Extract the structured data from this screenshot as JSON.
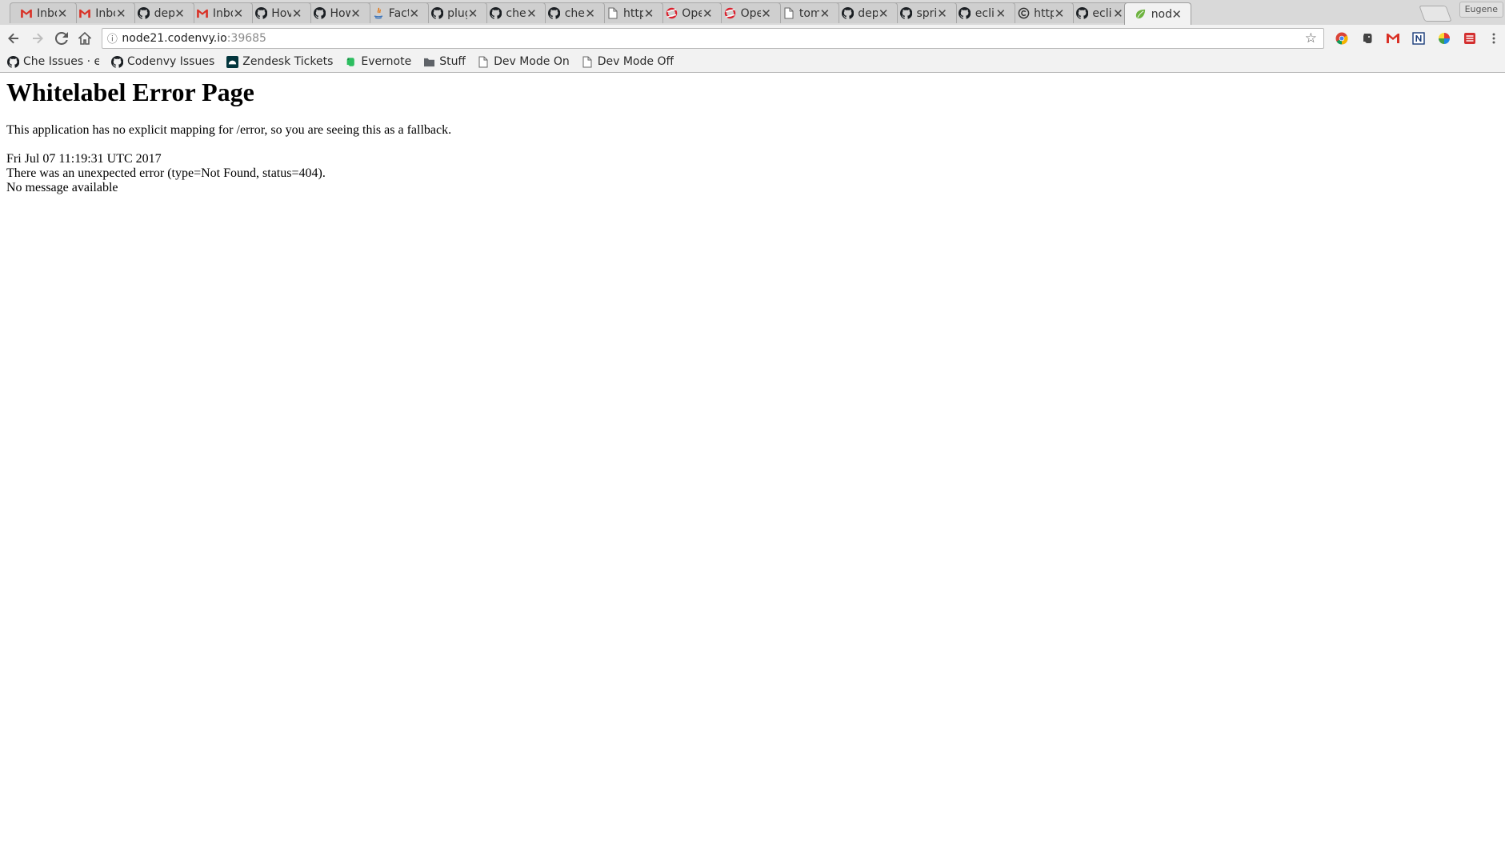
{
  "browser": {
    "profile_name": "Eugene",
    "tabs": [
      {
        "title": "Inbo",
        "icon": "gmail-icon"
      },
      {
        "title": "Inbo",
        "icon": "gmail-icon"
      },
      {
        "title": "dep",
        "icon": "github-icon"
      },
      {
        "title": "Inbo",
        "icon": "gmail-icon"
      },
      {
        "title": "Hov",
        "icon": "github-icon"
      },
      {
        "title": "How",
        "icon": "github-icon"
      },
      {
        "title": "Fact",
        "icon": "java-icon"
      },
      {
        "title": "plug",
        "icon": "github-icon"
      },
      {
        "title": "che",
        "icon": "github-icon"
      },
      {
        "title": "che",
        "icon": "github-icon"
      },
      {
        "title": "http",
        "icon": "document-icon"
      },
      {
        "title": "Ope",
        "icon": "openshift-icon"
      },
      {
        "title": "Ope",
        "icon": "openshift-icon"
      },
      {
        "title": "tom",
        "icon": "document-icon"
      },
      {
        "title": "dep",
        "icon": "github-icon"
      },
      {
        "title": "spri",
        "icon": "github-icon"
      },
      {
        "title": "eclip",
        "icon": "github-icon"
      },
      {
        "title": "http",
        "icon": "copyright-icon"
      },
      {
        "title": "eclip",
        "icon": "github-icon"
      },
      {
        "title": "nod",
        "icon": "spring-leaf-icon",
        "active": true
      }
    ],
    "address": {
      "host": "node21.codenvy.io",
      "port": ":39685"
    },
    "bookmarks": [
      {
        "label": "Che Issues · eclip",
        "icon": "github-icon"
      },
      {
        "label": "Codenvy Issues",
        "icon": "github-icon"
      },
      {
        "label": "Zendesk Tickets",
        "icon": "zendesk-icon"
      },
      {
        "label": "Evernote",
        "icon": "evernote-icon"
      },
      {
        "label": "Stuff",
        "icon": "folder-icon"
      },
      {
        "label": "Dev Mode On",
        "icon": "document-icon"
      },
      {
        "label": "Dev Mode Off",
        "icon": "document-icon"
      }
    ],
    "colors": {
      "gmail": "#d93025",
      "github": "#1b1f23",
      "openshift": "#db212e",
      "spring": "#6db33f",
      "evernote": "#2dbe60"
    }
  },
  "page": {
    "title": "Whitelabel Error Page",
    "description": "This application has no explicit mapping for /error, so you are seeing this as a fallback.",
    "timestamp": "Fri Jul 07 11:19:31 UTC 2017",
    "error_line": "There was an unexpected error (type=Not Found, status=404).",
    "message": "No message available"
  }
}
